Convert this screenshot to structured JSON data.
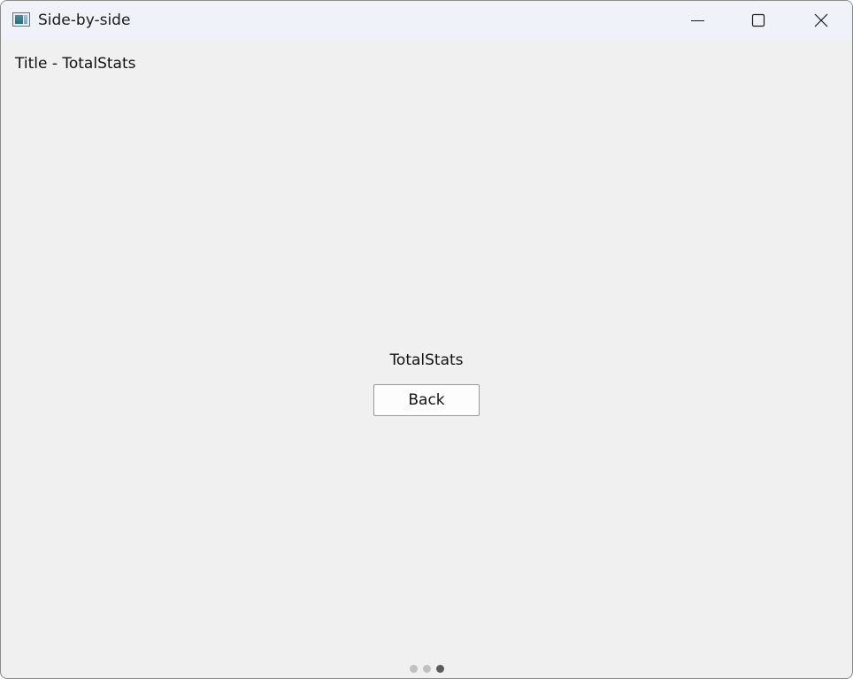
{
  "window": {
    "title": "Side-by-side",
    "controls": {
      "minimize_icon": "minimize-icon",
      "maximize_icon": "maximize-icon",
      "close_icon": "close-icon"
    }
  },
  "page": {
    "heading": "Title - TotalStats",
    "label": "TotalStats",
    "back_label": "Back"
  },
  "pager": {
    "total": 3,
    "active": 3,
    "active_color": "#5c5c5c",
    "inactive_color": "#c0c0c0"
  }
}
